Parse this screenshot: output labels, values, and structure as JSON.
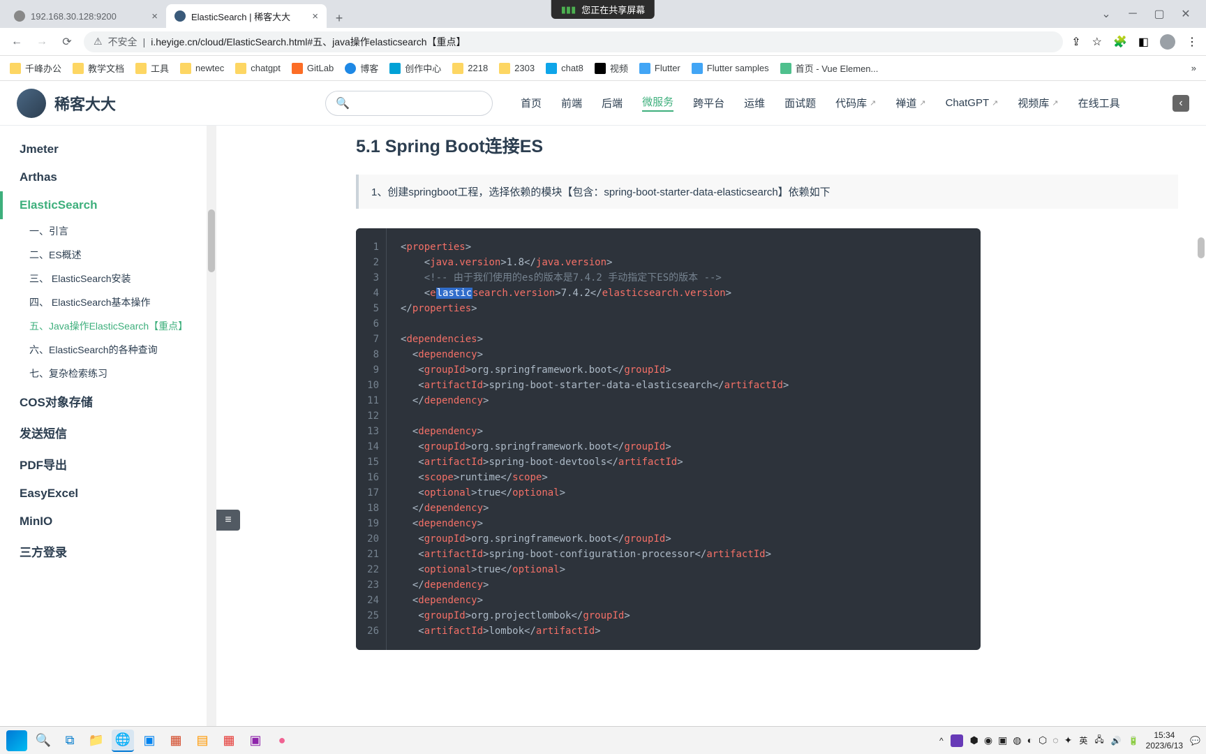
{
  "share_banner": "您正在共享屏幕",
  "tabs": [
    {
      "title": "192.168.30.128:9200",
      "active": false
    },
    {
      "title": "ElasticSearch | 稀客大大",
      "active": true
    }
  ],
  "url": {
    "security": "不安全",
    "text": "i.heyige.cn/cloud/ElasticSearch.html#五、java操作elasticsearch【重点】"
  },
  "bookmarks": [
    "千峰办公",
    "教学文档",
    "工具",
    "newtec",
    "chatgpt",
    "GitLab",
    "博客",
    "创作中心",
    "2218",
    "2303",
    "chat8",
    "视频",
    "Flutter",
    "Flutter samples",
    "首页 - Vue Elemen..."
  ],
  "site": {
    "title": "稀客大大",
    "nav": [
      "首页",
      "前端",
      "后端",
      "微服务",
      "跨平台",
      "运维",
      "面试题",
      "代码库",
      "禅道",
      "ChatGPT",
      "视频库",
      "在线工具"
    ]
  },
  "sidebar": {
    "items": [
      "Jmeter",
      "Arthas",
      "ElasticSearch",
      "COS对象存储",
      "发送短信",
      "PDF导出",
      "EasyExcel",
      "MinIO",
      "三方登录"
    ],
    "subitems": [
      "一、引言",
      "二、ES概述",
      "三、 ElasticSearch安装",
      "四、 ElasticSearch基本操作",
      "五、Java操作ElasticSearch【重点】",
      "六、ElasticSearch的各种查询",
      "七、复杂检索练习"
    ]
  },
  "content": {
    "heading": "5.1 Spring Boot连接ES",
    "note": "1、创建springboot工程，选择依赖的模块【包含：spring-boot-starter-data-elasticsearch】依赖如下"
  },
  "code_lines": [
    "1",
    "2",
    "3",
    "4",
    "5",
    "6",
    "7",
    "8",
    "9",
    "10",
    "11",
    "12",
    "13",
    "14",
    "15",
    "16",
    "17",
    "18",
    "19",
    "20",
    "21",
    "22",
    "23",
    "24",
    "25",
    "26"
  ],
  "tray": {
    "ime": "英",
    "time": "15:34",
    "date": "2023/6/13"
  }
}
